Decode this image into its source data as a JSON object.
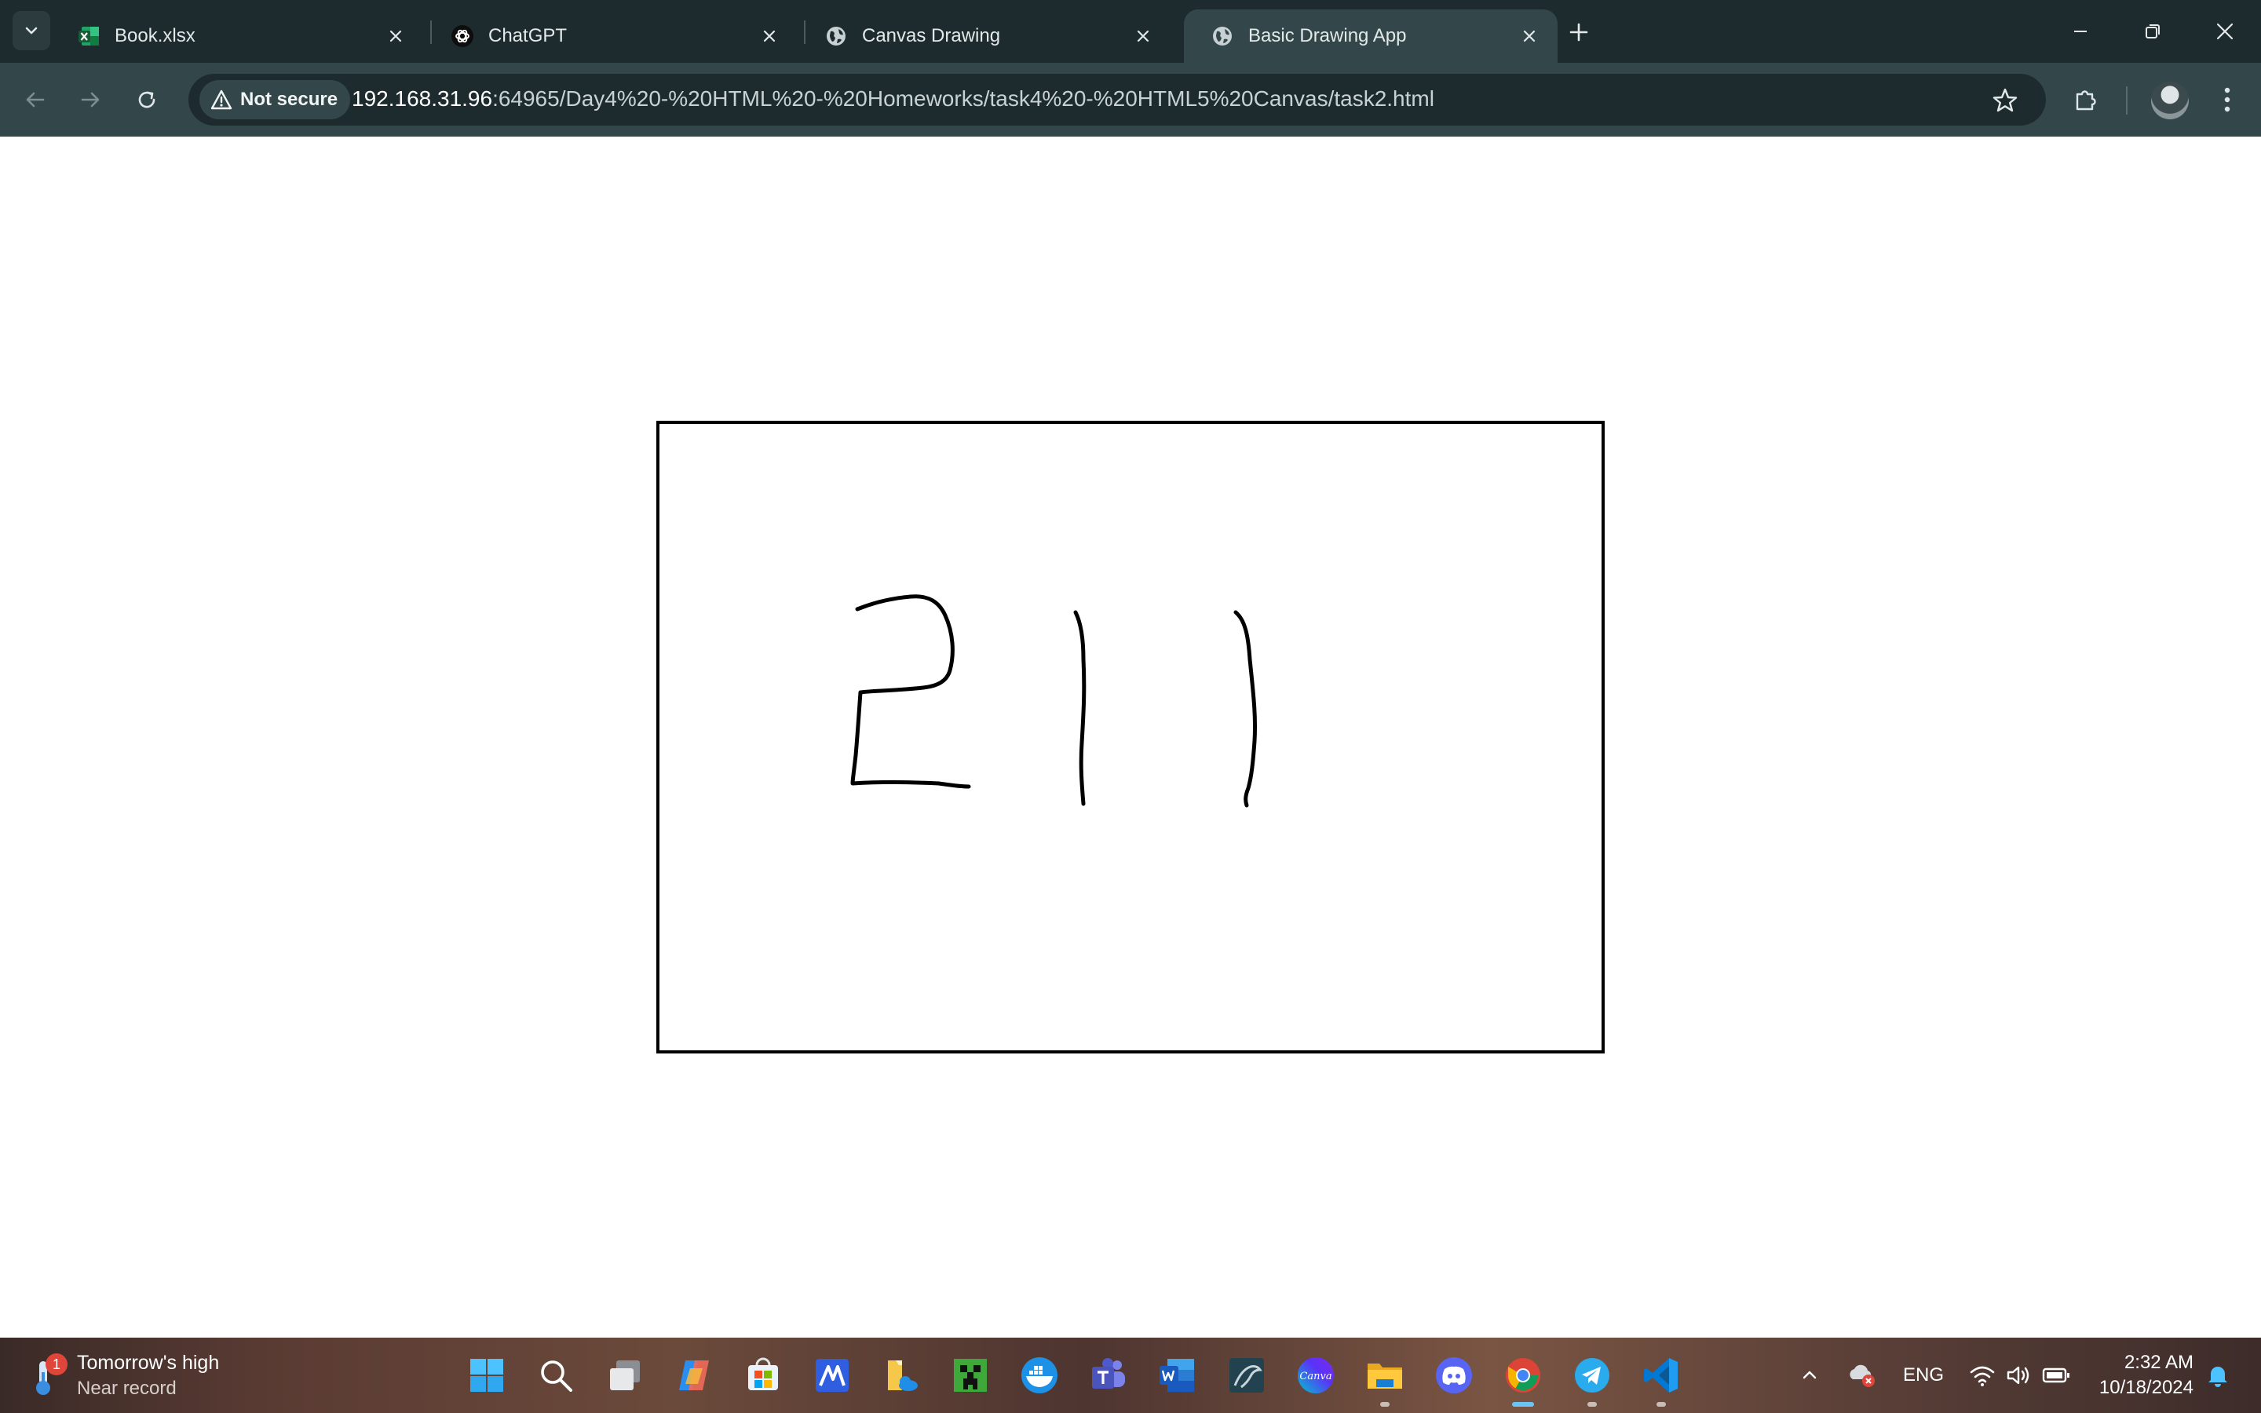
{
  "browser": {
    "tabs": [
      {
        "title": "Book.xlsx",
        "icon": "excel-icon",
        "active": false
      },
      {
        "title": "ChatGPT",
        "icon": "chatgpt-icon",
        "active": false
      },
      {
        "title": "Canvas Drawing",
        "icon": "globe-icon",
        "active": false
      },
      {
        "title": "Basic Drawing App",
        "icon": "globe-icon",
        "active": true
      }
    ],
    "security_label": "Not secure",
    "url_host": "192.168.31.96",
    "url_rest": ":64965/Day4%20-%20HTML%20-%20Homeworks/task4%20-%20HTML5%20Canvas/task2.html",
    "colors": {
      "tabstrip": "#1e2b2e",
      "toolbar": "#33474b",
      "omnibox": "#1e2b2e"
    }
  },
  "canvas": {
    "drawn_content": "211",
    "stroke_color": "#000000"
  },
  "taskbar": {
    "weather": {
      "line1": "Tomorrow's high",
      "line2": "Near record",
      "badge": "1"
    },
    "apps": [
      "windows-start",
      "search",
      "task-view",
      "copilot",
      "microsoft-store",
      "app-m",
      "file-explorer-onedrive",
      "minecraft",
      "docker",
      "teams",
      "word",
      "mysql-workbench",
      "canva",
      "file-explorer",
      "discord",
      "chrome",
      "telegram",
      "vscode"
    ],
    "language": "ENG",
    "time": "2:32 AM",
    "date": "10/18/2024"
  }
}
